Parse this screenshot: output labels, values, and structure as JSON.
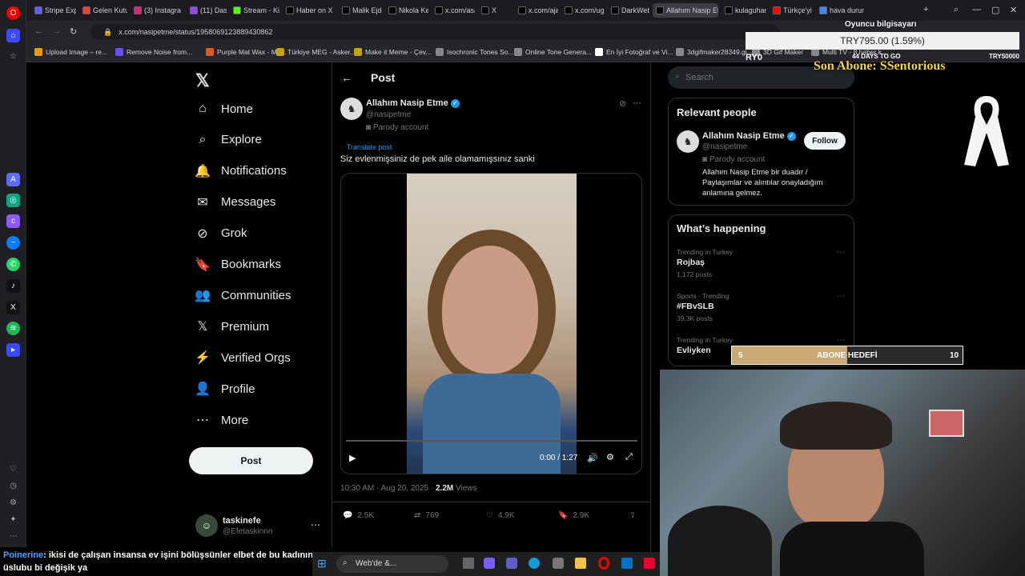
{
  "browser": {
    "tabs": [
      {
        "label": "Stripe Expr",
        "color": "#635bff"
      },
      {
        "label": "Gelen Kutu",
        "color": "#ea4335"
      },
      {
        "label": "(3) Instagra",
        "color": "#d62976"
      },
      {
        "label": "(11) Dashb",
        "color": "#9146ff"
      },
      {
        "label": "Stream - Ki",
        "color": "#53fc18"
      },
      {
        "label": "Haber on X",
        "color": "#000000"
      },
      {
        "label": "Malik Ejder",
        "color": "#000000"
      },
      {
        "label": "Nikola Kesl",
        "color": "#000000"
      },
      {
        "label": "x.com/asay",
        "color": "#000000"
      },
      {
        "label": "X",
        "color": "#000000"
      },
      {
        "label": "x.com/ajan",
        "color": "#000000"
      },
      {
        "label": "x.com/ugur",
        "color": "#000000"
      },
      {
        "label": "DarkWeb H",
        "color": "#000000"
      },
      {
        "label": "Allahım Nasip Etme",
        "color": "#000000",
        "active": true
      },
      {
        "label": "kulaguhan",
        "color": "#000000"
      },
      {
        "label": "Türkçe'yi A",
        "color": "#ff0000"
      },
      {
        "label": "hava durun",
        "color": "#4285f4"
      }
    ],
    "url": "x.com/nasipetme/status/1958069123889430862",
    "bookmarks": [
      {
        "label": "Upload Image – re...",
        "color": "#f29900"
      },
      {
        "label": "Remove Noise from...",
        "color": "#6a4cff"
      },
      {
        "label": "Purple Mat Wax - Me...",
        "color": "#e45a1b"
      },
      {
        "label": "Türkiye MEG - Asker...",
        "color": "#c8a200"
      },
      {
        "label": "Make it Meme - Çev...",
        "color": "#c8a200"
      },
      {
        "label": "Isochronic Tones So...",
        "color": "#888888"
      },
      {
        "label": "Online Tone Genera...",
        "color": "#888888"
      },
      {
        "label": "En İyi Fotoğraf ve Vi...",
        "color": "#ffffff"
      },
      {
        "label": "3dgifmaker28349.gi...",
        "color": "#888888"
      },
      {
        "label": "3D Gif Maker",
        "color": "#888888"
      },
      {
        "label": "Multi TV - 8 haber k...",
        "color": "#888888"
      }
    ]
  },
  "x_nav": {
    "items": [
      {
        "label": "Home",
        "icon": "⌂"
      },
      {
        "label": "Explore",
        "icon": "⌕"
      },
      {
        "label": "Notifications",
        "icon": "🔔"
      },
      {
        "label": "Messages",
        "icon": "✉"
      },
      {
        "label": "Grok",
        "icon": "⊘"
      },
      {
        "label": "Bookmarks",
        "icon": "🔖"
      },
      {
        "label": "Communities",
        "icon": "👥"
      },
      {
        "label": "Premium",
        "icon": "𝕏"
      },
      {
        "label": "Verified Orgs",
        "icon": "⚡"
      },
      {
        "label": "Profile",
        "icon": "👤"
      },
      {
        "label": "More",
        "icon": "⋯"
      }
    ],
    "post_label": "Post",
    "account": {
      "name": "taskinefe",
      "handle": "@Efetaskinnn"
    }
  },
  "post": {
    "header": "Post",
    "author": "Allahım Nasip Etme",
    "handle": "@nasipetme",
    "account_label": "Parody account",
    "translate": "Translate post",
    "text": "Siz evlenmişsiniz de pek aile olamamışsınız sanki",
    "video_time": "0:00 / 1:27",
    "timestamp": "10:30 AM · Aug 20, 2025 · ",
    "views_count": "2.2M",
    "views_label": "Views",
    "actions": {
      "replies": "2.5K",
      "reposts": "769",
      "likes": "4.9K",
      "bookmarks": "2.9K"
    }
  },
  "sidebar": {
    "search_placeholder": "Search",
    "relevant_title": "Relevant people",
    "person": {
      "name": "Allahım Nasip Etme",
      "handle": "@nasipetme",
      "account_label": "Parody account",
      "bio": "Allahım Nasip Etme bir duadır / Paylaşımlar ve alıntılar onayladığım anlamına gelmez.",
      "follow": "Follow"
    },
    "happening_title": "What’s happening",
    "trends": [
      {
        "meta": "Trending in Turkey",
        "title": "Rojbaş",
        "count": "1,172 posts"
      },
      {
        "meta": "Sports · Trending",
        "title": "#FBvSLB",
        "count": "39.3K posts"
      },
      {
        "meta": "Trending in Turkey",
        "title": "Evliyken",
        "count": ""
      }
    ]
  },
  "overlay": {
    "computer_label": "Oyuncu bilgisayarı",
    "price": "TRY795.00 (1.59%)",
    "price_left": "RY0",
    "days_to_go": "44 DAYS TO GO",
    "price_right": "TRY50000",
    "son_abone": "Son Abone: SSentorious",
    "goal_current": "5",
    "goal_label": "ABONE HEDEFİ",
    "goal_target": "10",
    "goal_fraction": 0.5
  },
  "chat": {
    "user": "Poinerine",
    "message": ": ikisi de çalışan insansa ev işini bölüşsünler elbet de bu kadının üslubu bi değişik ya"
  },
  "taskbar": {
    "search_placeholder": "Web'de &..."
  }
}
